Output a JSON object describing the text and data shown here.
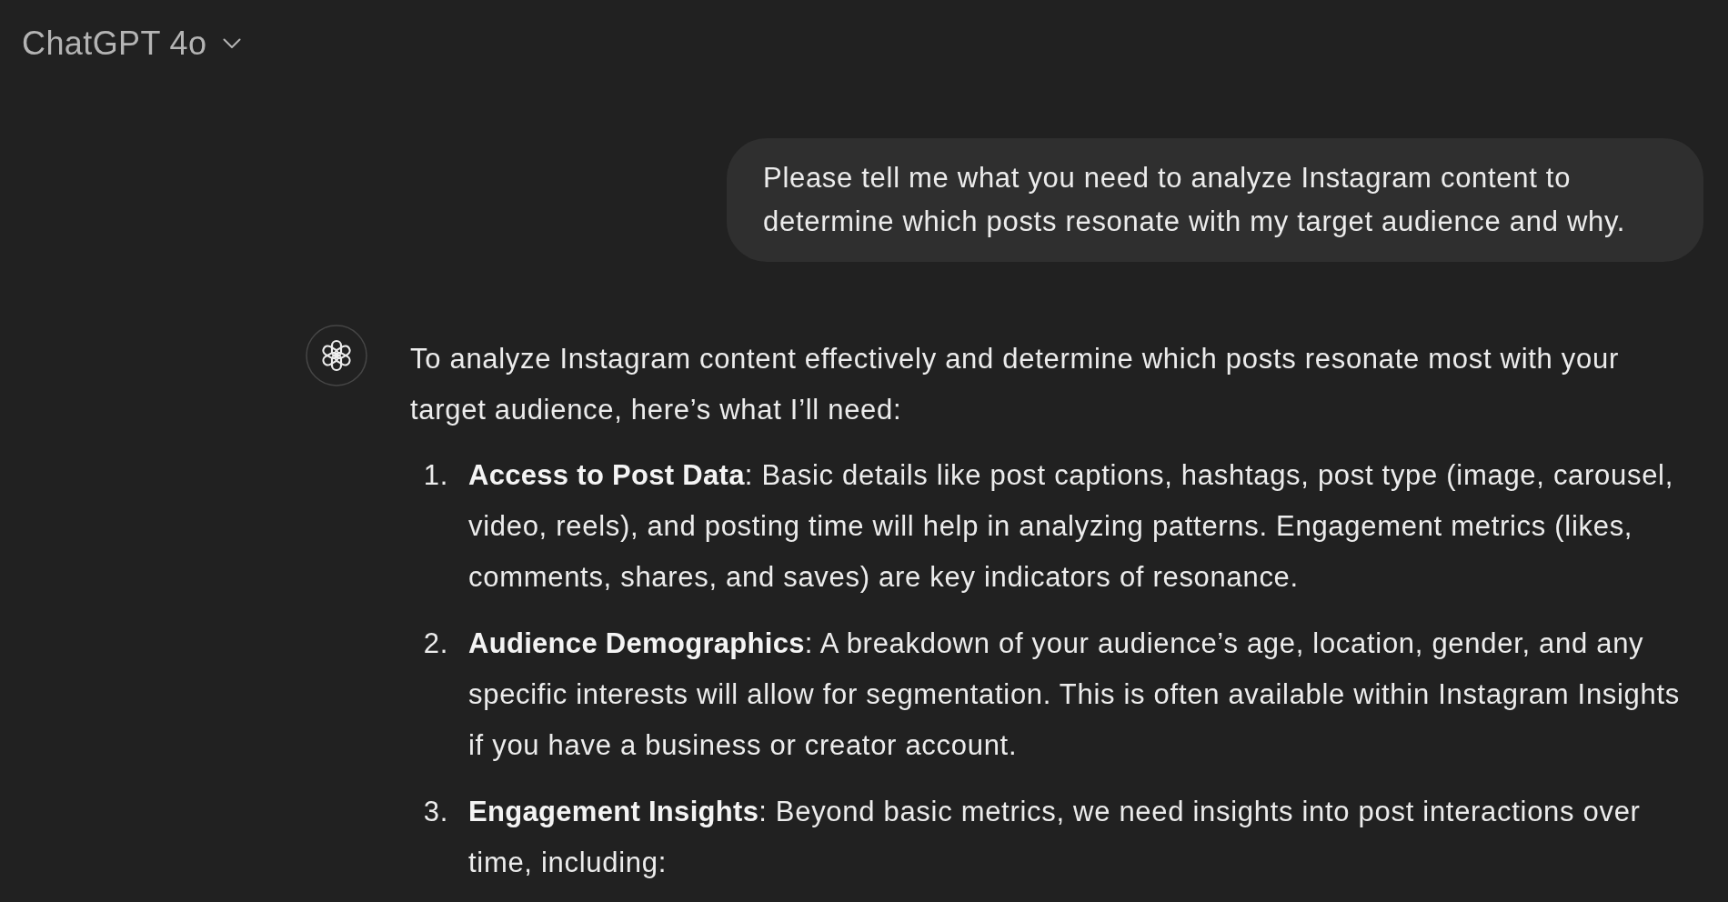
{
  "header": {
    "model_label": "ChatGPT 4o"
  },
  "messages": [
    {
      "kind": "user",
      "text": "Please tell me what you need to analyze Instagram content to determine which posts resonate with my target audience and why."
    },
    {
      "kind": "assistant",
      "paragraphs": [
        "To analyze Instagram content effectively and determine which posts resonate most with your target audience, here’s what I’ll need:"
      ],
      "list": [
        {
          "number": "1.",
          "text": "**Access to Post Data**: Basic details like post captions, hashtags, post type (image, carousel, video, reels), and posting time will help in analyzing patterns. Engagement metrics (likes, comments, shares, and saves) are key indicators of resonance."
        },
        {
          "number": "2.",
          "text": "**Audience Demographics**: A breakdown of your audience’s age, location, gender, and any specific interests will allow for segmentation. This is often available within Instagram Insights if you have a business or creator account."
        },
        {
          "number": "3.",
          "text": "**Engagement Insights**: Beyond basic metrics, we need insights into post interactions over time, including:"
        }
      ]
    }
  ]
}
